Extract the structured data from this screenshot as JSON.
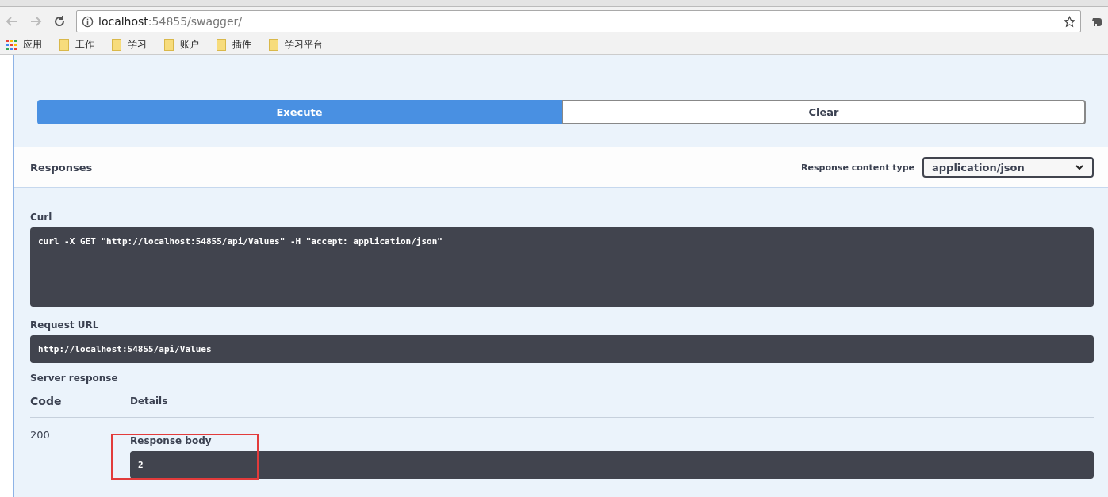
{
  "browser": {
    "address_host": "localhost",
    "address_path": ":54855/swagger/",
    "bookmarks": [
      {
        "label": "应用",
        "kind": "apps"
      },
      {
        "label": "工作",
        "kind": "folder"
      },
      {
        "label": "学习",
        "kind": "folder"
      },
      {
        "label": "账户",
        "kind": "folder"
      },
      {
        "label": "插件",
        "kind": "folder"
      },
      {
        "label": "学习平台",
        "kind": "folder"
      }
    ]
  },
  "actions": [
    {
      "label": "Execute",
      "kind": "primary"
    },
    {
      "label": "Clear",
      "kind": "secondary"
    }
  ],
  "responses": {
    "title": "Responses",
    "content_type_label": "Response content type",
    "content_type": "application/json"
  },
  "curl": {
    "label": "Curl",
    "value": "curl -X GET \"http://localhost:54855/api/Values\" -H \"accept: application/json\""
  },
  "request_url": {
    "label": "Request URL",
    "value": "http://localhost:54855/api/Values"
  },
  "server_response": {
    "label": "Server response",
    "code_heading": "Code",
    "details_heading": "Details",
    "rows": [
      {
        "code": "200",
        "body_label": "Response body",
        "body": "2",
        "highlighted": true
      }
    ]
  }
}
